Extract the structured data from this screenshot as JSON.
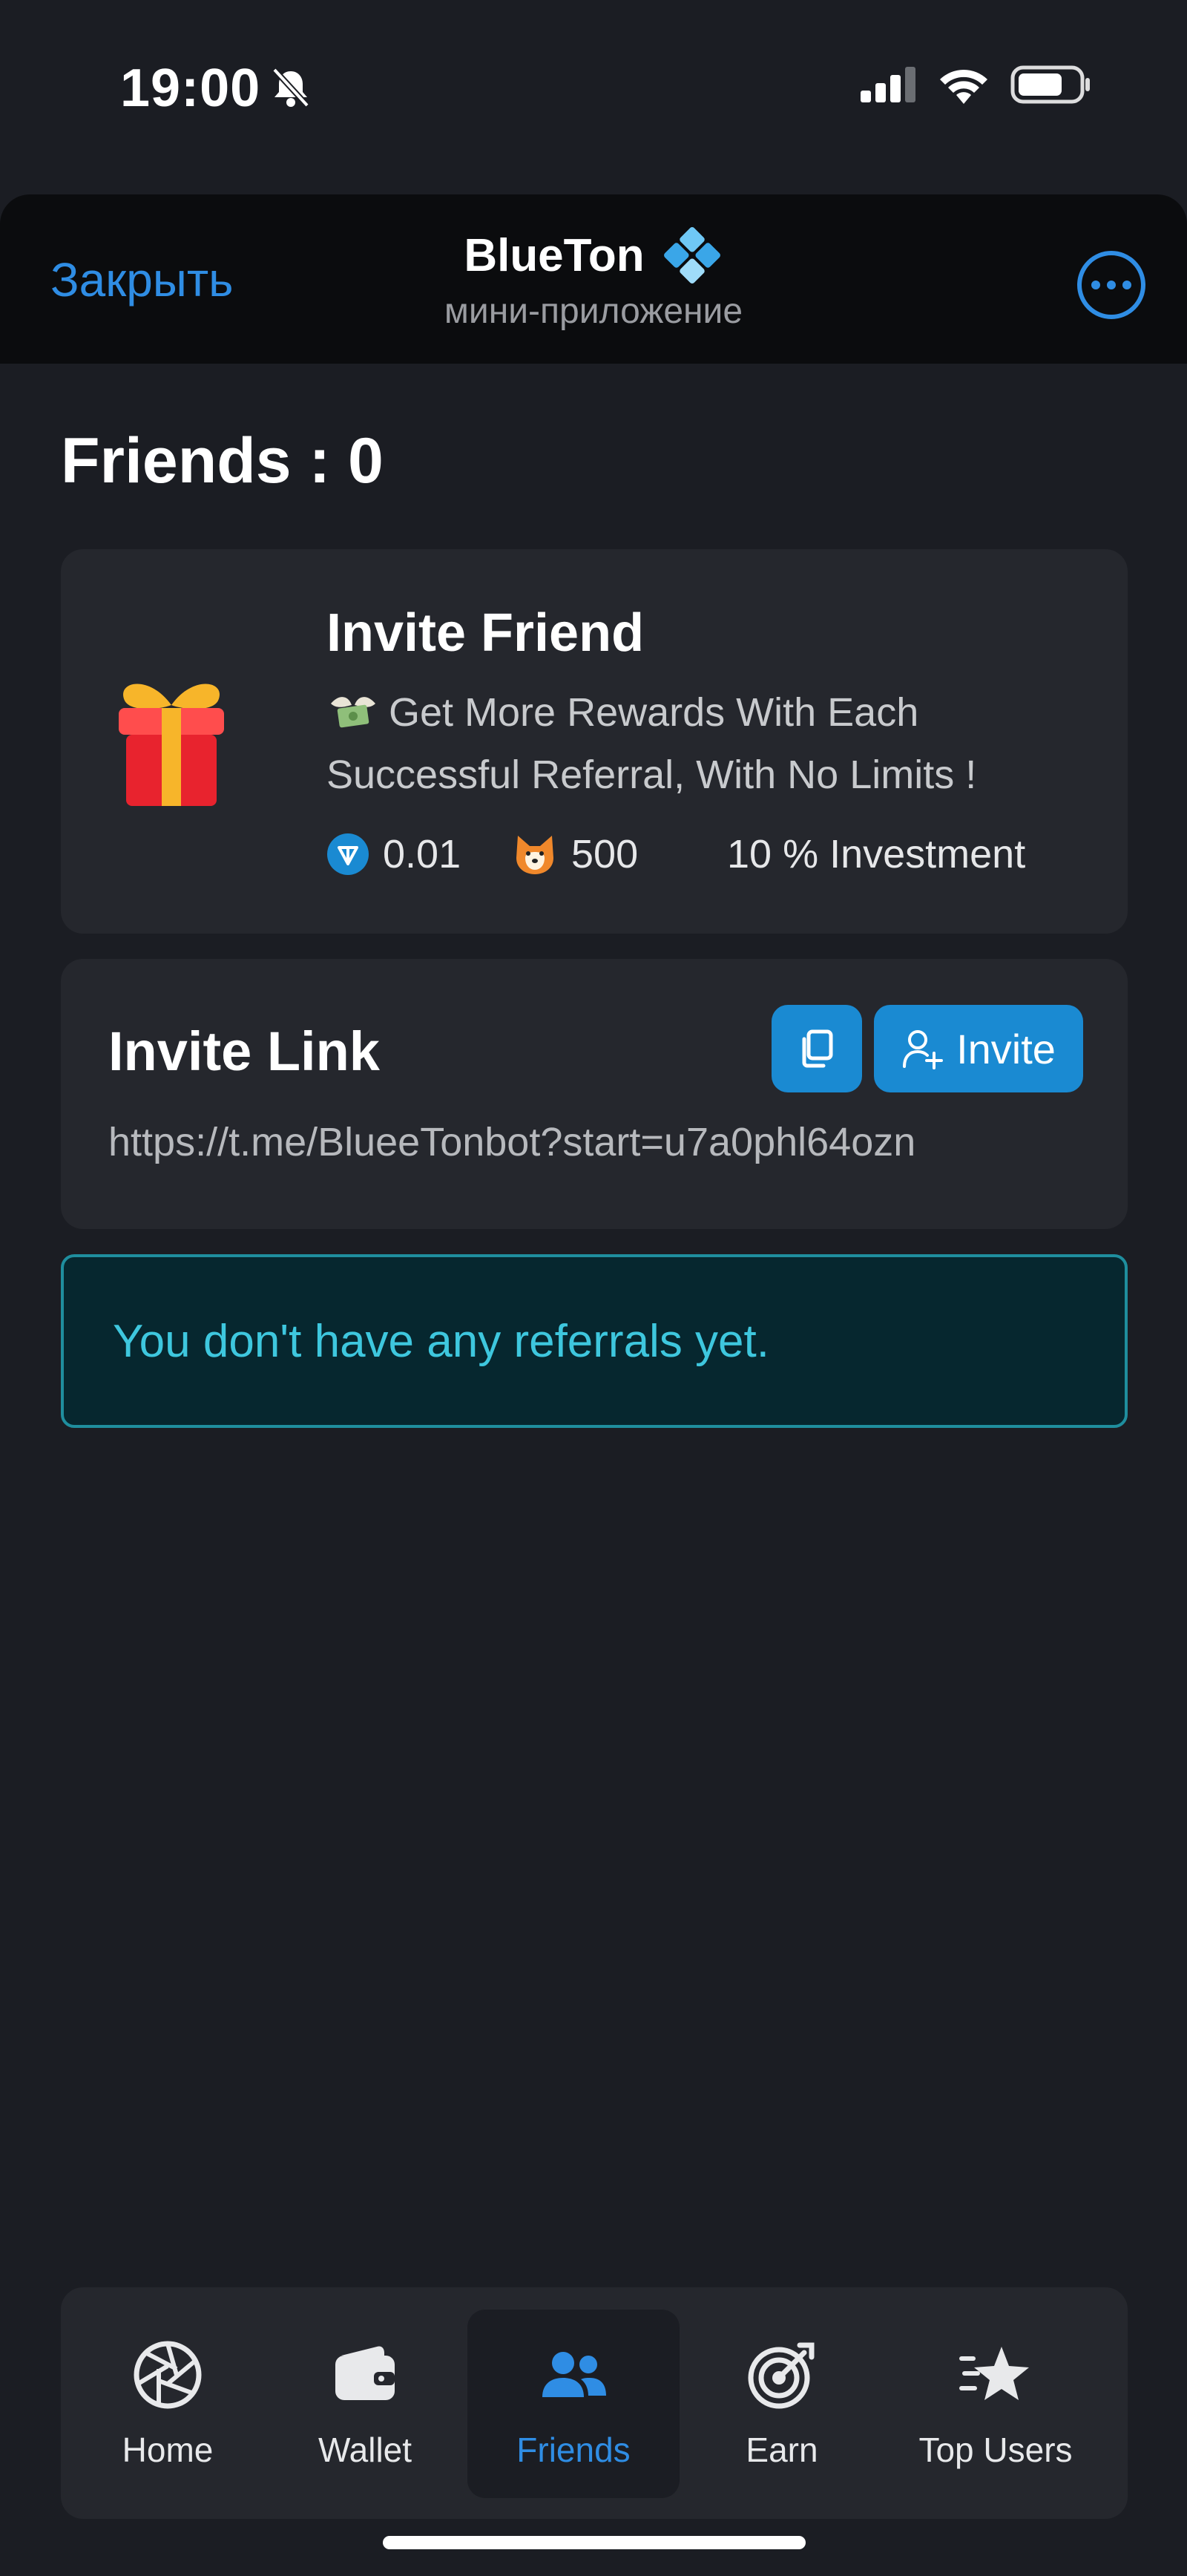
{
  "status_bar": {
    "time": "19:00"
  },
  "header": {
    "close_label": "Закрыть",
    "title": "BlueTon",
    "subtitle": "мини-приложение"
  },
  "friends": {
    "heading": "Friends : 0"
  },
  "invite_friend": {
    "title": "Invite Friend",
    "description": "Get More Rewards With Each Successful Referral, With No Limits !",
    "rewards": [
      {
        "icon": "ton-coin-icon",
        "value": "0.01"
      },
      {
        "icon": "shiba-coin-icon",
        "value": "500"
      },
      {
        "value": "10 % Investment"
      }
    ]
  },
  "invite_link": {
    "title": "Invite Link",
    "invite_button_label": "Invite",
    "url": "https://t.me/BlueeTonbot?start=u7a0phl64ozn"
  },
  "referrals_notice": "You don't have any referrals yet.",
  "bottom_nav": {
    "items": [
      {
        "label": "Home",
        "icon": "aperture-icon"
      },
      {
        "label": "Wallet",
        "icon": "wallet-icon"
      },
      {
        "label": "Friends",
        "icon": "users-icon"
      },
      {
        "label": "Earn",
        "icon": "target-icon"
      },
      {
        "label": "Top Users",
        "icon": "star-icon"
      }
    ],
    "active": "Friends"
  },
  "colors": {
    "accent": "#2f8de4",
    "button": "#1a8ad2",
    "notice_text": "#3ec7de",
    "notice_border": "#1f8e9e",
    "card": "#25272d",
    "background": "#1b1d23"
  }
}
